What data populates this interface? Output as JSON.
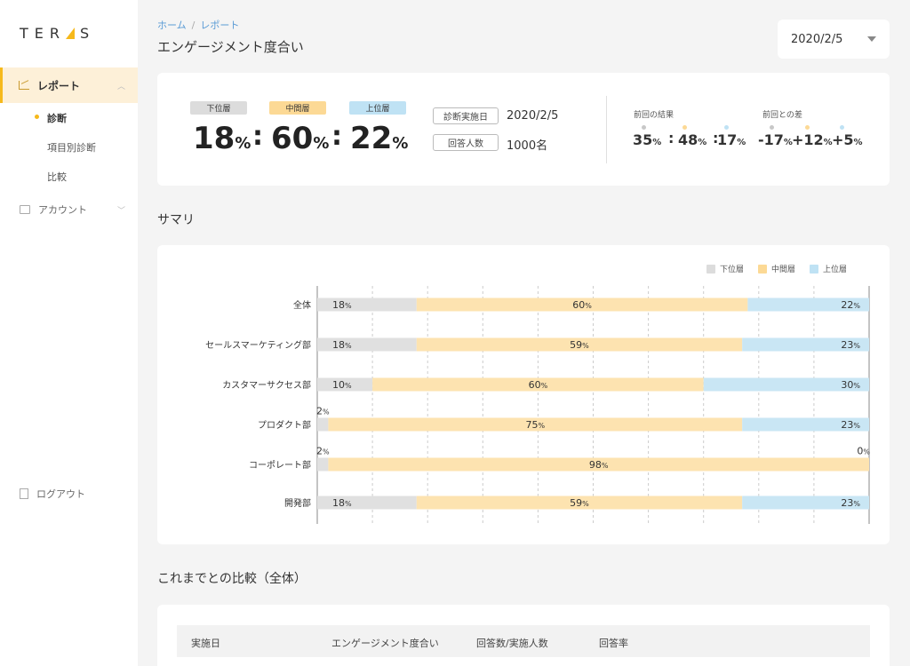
{
  "logo": {
    "text": "TERAS"
  },
  "sidebar": {
    "report": "レポート",
    "sub": [
      "診断",
      "項目別診断",
      "比較"
    ],
    "account": "アカウント",
    "logout": "ログアウト"
  },
  "header": {
    "breadcrumb": [
      "ホーム",
      "レポート"
    ],
    "title": "エンゲージメント度合い",
    "date": "2020/2/5"
  },
  "summary_card": {
    "tags": [
      "下位層",
      "中間層",
      "上位層"
    ],
    "big": [
      "18",
      "60",
      "22"
    ],
    "pct": "%",
    "info": [
      {
        "label": "診断実施日",
        "value": "2020/2/5"
      },
      {
        "label": "回答人数",
        "value": "1000名"
      }
    ],
    "prev_label": "前回の結果",
    "prev": [
      "35",
      "48",
      "17"
    ],
    "diff_label": "前回との差",
    "diff": [
      "-17",
      "+12",
      "+5"
    ]
  },
  "sections": {
    "summary": "サマリ",
    "comparison": "これまでとの比較（全体）"
  },
  "colors": {
    "lower": "#e0e0e0",
    "middle": "#fde3b0",
    "upper": "#c9e6f4",
    "accent": "#f6b91b"
  },
  "chart_data": {
    "type": "bar",
    "orientation": "horizontal-stacked-100",
    "legend": [
      "下位層",
      "中間層",
      "上位層"
    ],
    "legend_position": "top-right",
    "grid": true,
    "categories": [
      "全体",
      "セールスマーケティング部",
      "カスタマーサクセス部",
      "プロダクト部",
      "コーポレート部",
      "開発部"
    ],
    "series": [
      {
        "name": "下位層",
        "values": [
          18,
          18,
          10,
          2,
          2,
          18
        ]
      },
      {
        "name": "中間層",
        "values": [
          60,
          59,
          60,
          75,
          98,
          59
        ]
      },
      {
        "name": "上位層",
        "values": [
          22,
          23,
          30,
          23,
          0,
          23
        ]
      }
    ],
    "xlim": [
      0,
      100
    ]
  },
  "table": {
    "headers": [
      "実施日",
      "エンゲージメント度合い",
      "回答数/実施人数",
      "回答率"
    ]
  }
}
